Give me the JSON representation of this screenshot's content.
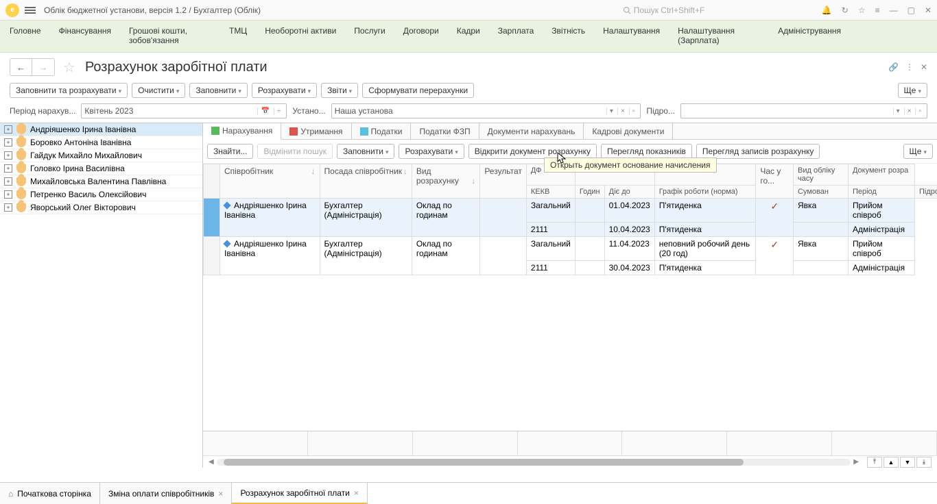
{
  "titlebar": {
    "title": "Облік бюджетної установи, версія 1.2 / Бухгалтер   (Облік)",
    "search_placeholder": "Пошук Ctrl+Shift+F"
  },
  "mainmenu": [
    "Головне",
    "Фінансування",
    "Грошові кошти, зобов'язання",
    "ТМЦ",
    "Необоротні активи",
    "Послуги",
    "Договори",
    "Кадри",
    "Зарплата",
    "Звітність",
    "Налаштування",
    "Налаштування (Зарплата)",
    "Адміністрування"
  ],
  "page": {
    "title": "Розрахунок заробітної плати",
    "toolbar": {
      "fill_calc": "Заповнити та розрахувати",
      "clear": "Очистити",
      "fill": "Заповнити",
      "calc": "Розрахувати",
      "reports": "Звіти",
      "form_recalc": "Сформувати перерахунки",
      "more": "Ще"
    }
  },
  "period": {
    "label": "Період нарахув...",
    "value": "Квітень 2023",
    "ust_label": "Устано...",
    "ust_value": "Наша установа",
    "pid_label": "Підро..."
  },
  "employees": [
    {
      "name": "Андріяшенко Ірина Іванівна",
      "selected": true
    },
    {
      "name": "Боровко Антоніна Іванівна"
    },
    {
      "name": "Гайдук Михайло Михайлович"
    },
    {
      "name": "Головко Ірина Василівна"
    },
    {
      "name": "Михайловська Валентина Павлівна"
    },
    {
      "name": "Петренко Василь Олексійович"
    },
    {
      "name": "Яворський Олег Вікторович"
    }
  ],
  "tabs": [
    "Нарахування",
    "Утримання",
    "Податки",
    "Податки ФЗП",
    "Документи нарахувань",
    "Кадрові документи"
  ],
  "subtoolbar": {
    "find": "Знайти...",
    "cancel_find": "Відмінити пошук",
    "fill": "Заповнити",
    "calc": "Розрахувати",
    "open_doc": "Відкрити документ розрахунку",
    "view_ind": "Перегляд показників",
    "view_rec": "Перегляд записів розрахунку",
    "more": "Ще",
    "tooltip": "Открыть документ основание начисления"
  },
  "grid": {
    "headers": {
      "emp": "Співробітник",
      "pos": "Посада співробітник",
      "calc_type": "Вид розрахунку",
      "result": "Результат",
      "df": "ДФ",
      "kekv": "КЕКВ",
      "hours": "Годин",
      "valid_to": "Діє до",
      "schedule": "Графік роботи (норма)",
      "time_h": "Час у го...",
      "sum": "Сумован",
      "acct_type": "Вид обліку часу",
      "period_h": "Період",
      "doc": "Документ розра",
      "dept": "Підрозділ"
    },
    "rows": [
      {
        "emp": "Андріяшенко Ірина Іванівна",
        "pos": "Бухгалтер (Адміністрація)",
        "calc_type": "Оклад по годинам",
        "df": "Загальний",
        "kekv": "2111",
        "valid_to1": "01.04.2023",
        "valid_to2": "10.04.2023",
        "sched1": "П'ятиденка",
        "sched2": "П'ятиденка",
        "check": true,
        "acct": "Явка",
        "doc": "Прийом співроб",
        "dept": "Адміністрація",
        "selected": true
      },
      {
        "emp": "Андріяшенко Ірина Іванівна",
        "pos": "Бухгалтер (Адміністрація)",
        "calc_type": "Оклад по годинам",
        "df": "Загальний",
        "kekv": "2111",
        "valid_to1": "11.04.2023",
        "valid_to2": "30.04.2023",
        "sched1": "неповний робочий день (20 год)",
        "sched2": "П'ятиденка",
        "check": true,
        "acct": "Явка",
        "doc": "Прийом співроб",
        "dept": "Адміністрація"
      }
    ]
  },
  "bottomtabs": {
    "home": "Початкова сторінка",
    "t1": "Зміна оплати співробітників",
    "t2": "Розрахунок заробітної плати"
  }
}
